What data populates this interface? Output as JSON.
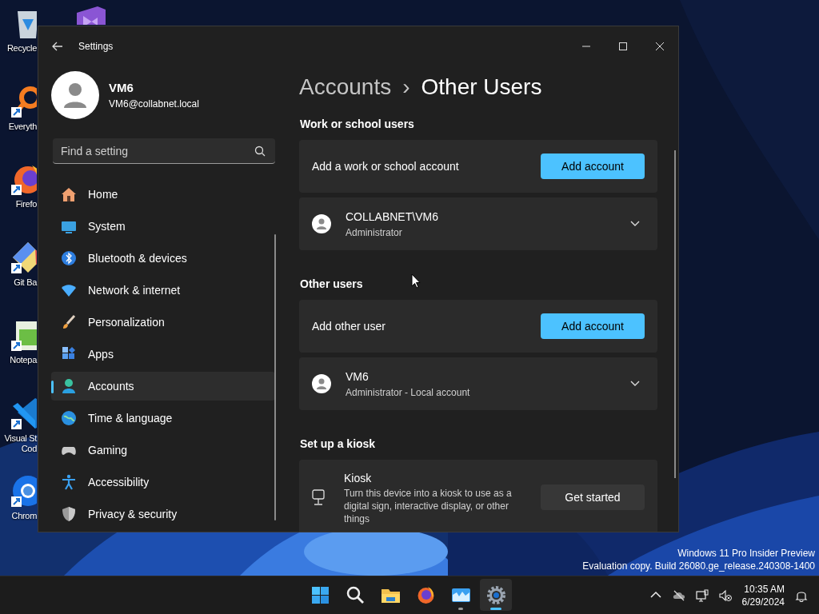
{
  "desktop_icons": [
    {
      "kind": "visualstudio"
    },
    {
      "kind": "recycle",
      "shortcut": false,
      "label_lines": [
        "Recycle"
      ]
    },
    {
      "kind": "everything",
      "shortcut": true,
      "label_lines": [
        "Everyth"
      ]
    },
    {
      "kind": "firefox",
      "shortcut": true,
      "label_lines": [
        "Firefo"
      ]
    },
    {
      "kind": "git",
      "shortcut": true,
      "label_lines": [
        "Git Ba"
      ]
    },
    {
      "kind": "notepad",
      "shortcut": true,
      "label_lines": [
        "Notepa"
      ]
    },
    {
      "kind": "vscode",
      "shortcut": true,
      "label_lines": [
        "Visual St",
        "Cod"
      ]
    },
    {
      "kind": "chrome",
      "shortcut": true,
      "label_lines": [
        "Chrom"
      ]
    }
  ],
  "window": {
    "title": "Settings",
    "user": {
      "name": "VM6",
      "email": "VM6@collabnet.local"
    },
    "search": {
      "placeholder": "Find a setting"
    },
    "nav": [
      {
        "kind": "home",
        "label": "Home",
        "selected": false
      },
      {
        "kind": "system",
        "label": "System",
        "selected": false
      },
      {
        "kind": "bluetooth",
        "label": "Bluetooth & devices",
        "selected": false
      },
      {
        "kind": "network",
        "label": "Network & internet",
        "selected": false
      },
      {
        "kind": "personalization",
        "label": "Personalization",
        "selected": false
      },
      {
        "kind": "apps",
        "label": "Apps",
        "selected": false
      },
      {
        "kind": "accounts",
        "label": "Accounts",
        "selected": true
      },
      {
        "kind": "time",
        "label": "Time & language",
        "selected": false
      },
      {
        "kind": "gaming",
        "label": "Gaming",
        "selected": false
      },
      {
        "kind": "accessibility",
        "label": "Accessibility",
        "selected": false
      },
      {
        "kind": "privacy",
        "label": "Privacy & security",
        "selected": false
      }
    ],
    "breadcrumb": {
      "parent": "Accounts",
      "separator": "›",
      "current": "Other Users"
    },
    "sections": [
      {
        "heading": "Work or school users",
        "rows": [
          {
            "kind": "action",
            "label": "Add a work or school account",
            "button": {
              "label": "Add account"
            }
          },
          {
            "kind": "user",
            "name": "COLLABNET\\VM6",
            "detail": "Administrator",
            "expanded": false
          }
        ]
      },
      {
        "heading": "Other users",
        "rows": [
          {
            "kind": "action",
            "label": "Add other user",
            "button": {
              "label": "Add account"
            }
          },
          {
            "kind": "user",
            "name": "VM6",
            "detail": "Administrator - Local account",
            "expanded": false
          }
        ]
      },
      {
        "heading": "Set up a kiosk",
        "rows": [
          {
            "kind": "kiosk",
            "title": "Kiosk",
            "description": "Turn this device into a kiosk to use as a digital sign, interactive display, or other things",
            "button": {
              "label": "Get started"
            }
          }
        ]
      }
    ]
  },
  "watermark": [
    "Windows 11 Pro Insider Preview",
    "Evaluation copy. Build 26080.ge_release.240308-1400"
  ],
  "taskbar": {
    "apps": [
      {
        "kind": "start",
        "running": false,
        "selected": false
      },
      {
        "kind": "search",
        "running": false,
        "selected": false
      },
      {
        "kind": "explorer",
        "running": false,
        "selected": false
      },
      {
        "kind": "firefox",
        "running": false,
        "selected": false
      },
      {
        "kind": "photos",
        "running": true,
        "selected": false
      },
      {
        "kind": "settings",
        "running": true,
        "selected": true
      }
    ],
    "time": "10:35 AM",
    "date": "6/29/2024"
  }
}
